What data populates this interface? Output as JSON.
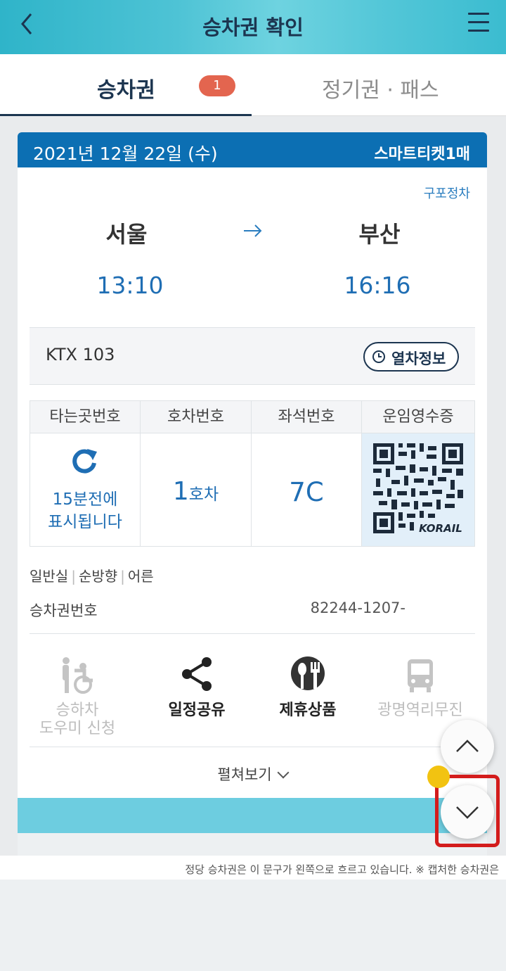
{
  "header": {
    "title": "승차권 확인"
  },
  "tabs": [
    {
      "label": "승차권",
      "badge": "1"
    },
    {
      "label": "정기권 · 패스"
    }
  ],
  "ticket": {
    "date": "2021년 12월 22일 (수)",
    "ticket_type": "스마트티켓1매",
    "route_note": "구포정차",
    "from": "서울",
    "to": "부산",
    "dep_time": "13:10",
    "arr_time": "16:16",
    "train": "KTX 103",
    "train_info_button": "열차정보",
    "grid": {
      "headers": [
        "타는곳번호",
        "호차번호",
        "좌석번호",
        "운임영수증"
      ],
      "platform_line1": "15분전에",
      "platform_line2": "표시됩니다",
      "car_number": "1",
      "car_suffix": "호차",
      "seat": "7C",
      "qr_brand": "KORAIL"
    },
    "class_info": [
      "일반실",
      "순방향",
      "어른"
    ],
    "ticket_number_label": "승차권번호",
    "ticket_number": "82244-1207-",
    "actions": [
      {
        "label_line1": "승하차",
        "label_line2": "도우미 신청",
        "icon": "wheelchair-assist-icon",
        "enabled": false
      },
      {
        "label_line1": "일정공유",
        "icon": "share-icon",
        "enabled": true
      },
      {
        "label_line1": "제휴상품",
        "icon": "dining-icon",
        "enabled": true
      },
      {
        "label_line1": "광명역리무진",
        "icon": "bus-icon",
        "enabled": false
      }
    ],
    "expand_label": "펼쳐보기"
  },
  "marquee": "정당 승차권은 이 문구가 왼쪽으로 흐르고 있습니다. ※ 캡처한 승차권은",
  "colors": {
    "header": "#4ec3d5",
    "card_header": "#0c6fb3",
    "accent_text": "#1f6eb4",
    "badge": "#e3654f",
    "highlight": "#d31c1c"
  }
}
